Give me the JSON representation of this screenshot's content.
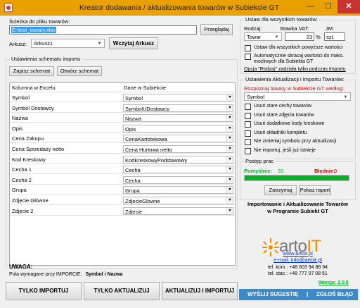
{
  "window": {
    "title": "Kreator dodawania / aktualizowania towarów w Subiekcie GT",
    "minimize": "—",
    "maximize": "☐",
    "close": "✕"
  },
  "file": {
    "path_label": "Ścieżka do pliku towarów:",
    "path_value": "E:\\test_towary.xlsx",
    "browse_button": "Przeglądaj",
    "sheet_label": "Arkusz:",
    "sheet_value": "Arkusz1",
    "load_button": "Wczytaj Arkusz"
  },
  "schema": {
    "group_title": "Ustawienia schematu importu",
    "save_button": "Zapisz schemat",
    "open_button": "Otwórz schemat",
    "col_excel": "Kolumna w Excelu",
    "col_subiekt": "Dane w Subiekcie",
    "rows": [
      {
        "excel": "Symbol",
        "subiekt": "Symbol"
      },
      {
        "excel": "Symbol Dostawcy",
        "subiekt": "SymbolUDostawcy"
      },
      {
        "excel": "Nazwa",
        "subiekt": "Nazwa"
      },
      {
        "excel": "Opis",
        "subiekt": "Opis"
      },
      {
        "excel": "Cena Zakupu",
        "subiekt": "CenaKartotekowa"
      },
      {
        "excel": "Cena Sprzedaży netto",
        "subiekt": "Cena Hurtowa netto"
      },
      {
        "excel": "Kod Kreskowy",
        "subiekt": "KodKreskowyPodstawowy"
      },
      {
        "excel": "Cecha 1",
        "subiekt": "Cecha"
      },
      {
        "excel": "Cecha 2",
        "subiekt": "Cecha"
      },
      {
        "excel": "Grupa",
        "subiekt": "Grupa"
      },
      {
        "excel": "Zdjęcie Główne",
        "subiekt": "ZdjecieGlowne"
      },
      {
        "excel": "Zdjęcie 2",
        "subiekt": "Zdjecie"
      }
    ]
  },
  "warning": {
    "title": "UWAGA:",
    "text": "Pola wymagane przy IMPORCIE:",
    "fields": "Symbol i Nazwa"
  },
  "actions": {
    "import_only": "TYLKO IMPORTUJ",
    "update_only": "TYLKO AKTUALIZUJ",
    "update_and_import": "AKTUALIZUJ I IMPORTUJ"
  },
  "all_items": {
    "group_title": "Ustaw dla wszystkich towarów:",
    "kind_label": "Rodzaj:",
    "kind_value": "Towar",
    "vat_label": "Stawka VAT:",
    "vat_value": "23",
    "vat_unit": "%",
    "unit_label": "JM:",
    "unit_value": "szt.",
    "cb_apply_all": "Ustaw dla wszystkich powyższe wartości",
    "cb_truncate": "Automatycznie skracaj wartości do maks. możliwych dla Subiekta GT",
    "note": "Opcja \"Rodzaj\" zadziała tylko podczas Importu"
  },
  "update_settings": {
    "group_title": "Ustawienia Aktualizacji i Importu Towarów:",
    "recognize_label": "Rozpoznaj towary w Subiekcie GT według:",
    "recognize_value": "Symbol",
    "options": [
      "Usuń stare cechy towarów",
      "Usuń stare zdjęcia towarów",
      "Usuń dodatkowe kody kreskowe",
      "Usuń składniki kompletu",
      "Nie zmieniaj symbolu przy aktualizacji",
      "Nie importuj, jeśli już istnieje"
    ]
  },
  "progress": {
    "group_title": "Postęp prac",
    "success_label": "Pomyślnie:",
    "success_value": "33",
    "errors_label": "Błędnie:",
    "errors_value": "0",
    "fraction": 1.0,
    "stop_button": "Zatrzymaj",
    "report_button": "Pokaż raport",
    "bar_color": "#06b025"
  },
  "branding": {
    "headline_1": "Importowanie i Aktualizowanie Towarów",
    "headline_2": "w Programie Subiekt GT",
    "logo_a": "arto",
    "logo_b": "IT",
    "website": "www.artoit.pl",
    "email": "e-mail: info@artoit.pl",
    "phone_mobile": "tel. kom.: +48 603 94 88 94",
    "phone_landline": "tel. stac.: +48 777 07 08 51",
    "version": "Wersja: 2.0.0"
  },
  "footer": {
    "suggest": "WYŚLIJ SUGESTIĘ",
    "separator": "|",
    "report_bug": "ZGŁOŚ BŁĄD"
  },
  "colors": {
    "titlebar": "#e8a100",
    "accent_blue": "#3d8ac7",
    "error_red": "#e00000",
    "success_green": "#06b025",
    "brand_orange": "#f08c00"
  }
}
